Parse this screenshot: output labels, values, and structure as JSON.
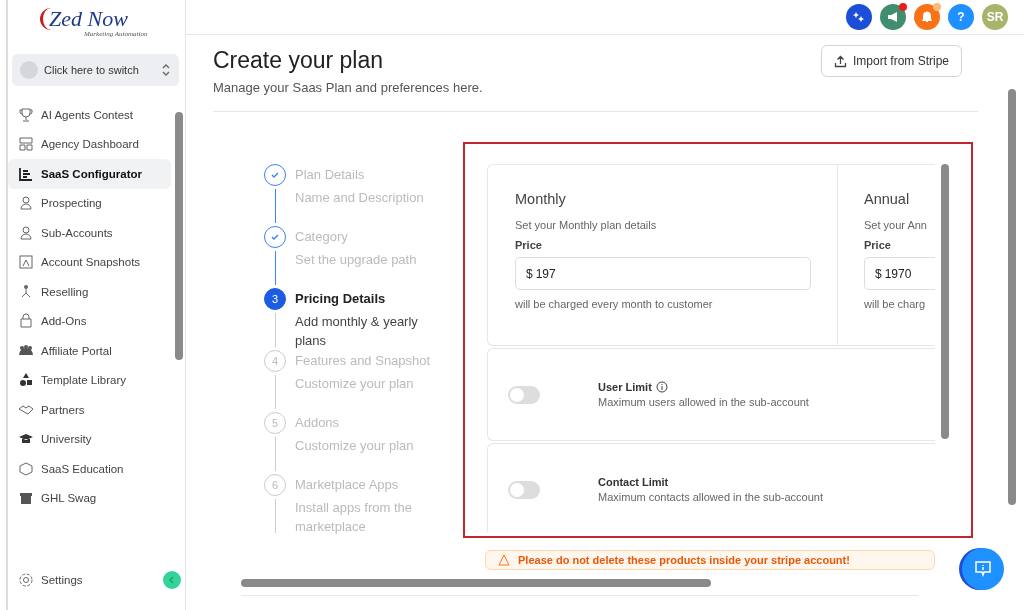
{
  "sidebar": {
    "logo": {
      "name": "Zed Now",
      "tagline": "Marketing Automation"
    },
    "switcher": "Click here to switch",
    "items": [
      {
        "label": "AI Agents Contest",
        "selected": false
      },
      {
        "label": "Agency Dashboard",
        "selected": false
      },
      {
        "label": "SaaS Configurator",
        "selected": true
      },
      {
        "label": "Prospecting",
        "selected": false
      },
      {
        "label": "Sub-Accounts",
        "selected": false
      },
      {
        "label": "Account Snapshots",
        "selected": false
      },
      {
        "label": "Reselling",
        "selected": false
      },
      {
        "label": "Add-Ons",
        "selected": false
      },
      {
        "label": "Affiliate Portal",
        "selected": false
      },
      {
        "label": "Template Library",
        "selected": false
      },
      {
        "label": "Partners",
        "selected": false
      },
      {
        "label": "University",
        "selected": false
      },
      {
        "label": "SaaS Education",
        "selected": false
      },
      {
        "label": "GHL Swag",
        "selected": false
      }
    ],
    "settings": "Settings"
  },
  "topbar": {
    "icons": [
      {
        "kind": "sparkle",
        "badge": false
      },
      {
        "kind": "megaphone",
        "badge": true
      },
      {
        "kind": "bell",
        "badge": true
      },
      {
        "kind": "help",
        "text": "?",
        "badge": false
      },
      {
        "kind": "avatar",
        "text": "SR",
        "badge": false
      }
    ]
  },
  "header": {
    "title": "Create your plan",
    "subtitle": "Manage your Saas Plan and preferences here.",
    "import_button": "Import from Stripe"
  },
  "steps": [
    {
      "title": "Plan Details",
      "description": "Name and Description",
      "done": true,
      "selected": false
    },
    {
      "title": "Category",
      "description": "Set the upgrade path",
      "done": true,
      "selected": false
    },
    {
      "number": "3",
      "title": "Pricing Details",
      "description": "Add monthly & yearly plans",
      "done": false,
      "selected": true
    },
    {
      "number": "4",
      "title": "Features and Snapshot",
      "description": "Customize your plan",
      "done": false,
      "selected": false
    },
    {
      "number": "5",
      "title": "Addons",
      "description": "Customize your plan",
      "done": false,
      "selected": false
    },
    {
      "number": "6",
      "title": "Marketplace Apps",
      "description": "Install apps from the marketplace",
      "done": false,
      "selected": false
    }
  ],
  "pricing": [
    {
      "title": "Monthly",
      "description": "Set your Monthly plan details",
      "price_label": "Price",
      "currency": "$",
      "value": "197",
      "note": "will be charged every month to customer"
    },
    {
      "title": "Annual",
      "description": "Set your Ann",
      "price_label": "Price",
      "currency": "$",
      "value": "1970",
      "note": "will be charg"
    }
  ],
  "limits": [
    {
      "title": "User Limit",
      "info": true,
      "description": "Maximum users allowed in the sub-account",
      "on": false
    },
    {
      "title": "Contact Limit",
      "info": false,
      "description": "Maximum contacts allowed in the sub-account",
      "on": false
    }
  ],
  "warning": "Please do not delete these products inside your stripe account!"
}
